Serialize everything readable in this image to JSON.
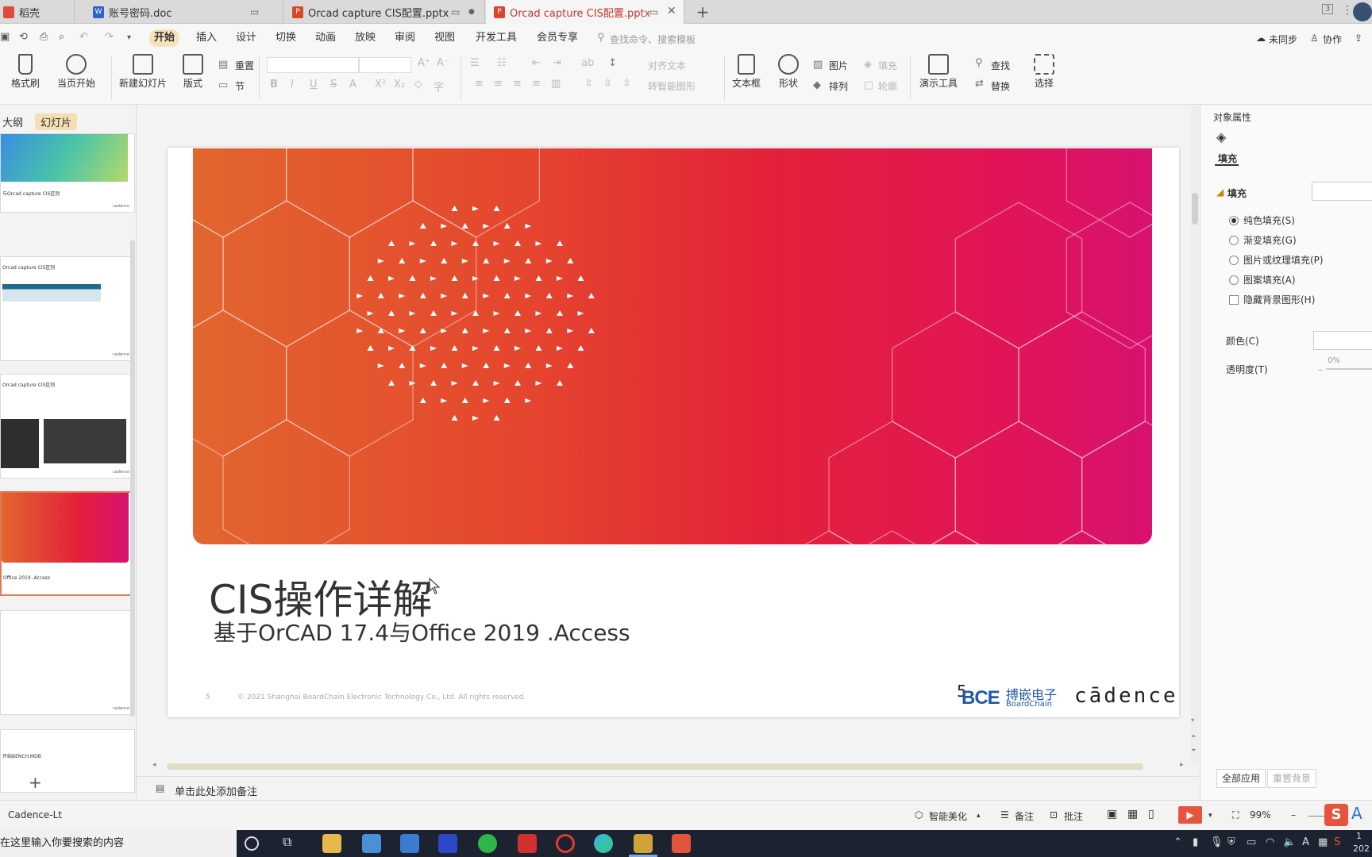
{
  "tabs": [
    {
      "label": "稻壳",
      "type": "daoke"
    },
    {
      "label": "账号密码.doc",
      "type": "doc"
    },
    {
      "label": "Orcad capture CIS配置.pptx",
      "type": "ppt"
    },
    {
      "label": "Orcad capture CIS配置.pptx",
      "type": "ppt",
      "active": true
    }
  ],
  "menu": {
    "items": [
      "开始",
      "插入",
      "设计",
      "切换",
      "动画",
      "放映",
      "审阅",
      "视图",
      "开发工具",
      "会员专享"
    ],
    "active": "开始",
    "search_placeholder": "查找命令、搜索模板",
    "sync": "未同步",
    "collab": "协作"
  },
  "ribbon": {
    "format_painter": "格式刷",
    "from_current": "当页开始",
    "new_slide": "新建幻灯片",
    "layout": "版式",
    "reset": "重置",
    "section": "节",
    "align_text": "对齐文本",
    "smartart": "转智能图形",
    "textbox": "文本框",
    "shape": "形状",
    "picture": "图片",
    "fill": "填充",
    "arrange": "排列",
    "outline": "轮廓",
    "presentation_tools": "演示工具",
    "find": "查找",
    "replace": "替换",
    "select": "选择"
  },
  "left_pane": {
    "tab_outline": "大纲",
    "tab_slides": "幻灯片",
    "thumbs": [
      {
        "title": "与Orcad capture CIS区别"
      },
      {
        "title": "Orcad capture CIS区别"
      },
      {
        "title": "Orcad capture CIS区别"
      },
      {
        "title": "Office 2019 .Access",
        "selected": true
      },
      {
        "title": ""
      },
      {
        "title": "开始BENCH.MDB"
      }
    ]
  },
  "slide": {
    "title": "CIS操作详解",
    "subtitle": "基于OrCAD 17.4与Office 2019 .Access",
    "number": "5",
    "copyright": "© 2021 Shanghai BoardChain Electronic Technology Co., Ltd. All rights reserved.",
    "logo_num": "5",
    "logo_bce": "BCE",
    "logo_cn": "搏嵌电子",
    "logo_en": "BoardChain",
    "logo_cadence": "cādence"
  },
  "notes_placeholder": "单击此处添加备注",
  "right_panel": {
    "header": "对象属性",
    "fill_tab": "填充",
    "fill_section": "填充",
    "options": [
      "纯色填充(S)",
      "渐变填充(G)",
      "图片或纹理填充(P)",
      "图案填充(A)"
    ],
    "selected_option": 0,
    "hide_bg": "隐藏背景图形(H)",
    "color_label": "颜色(C)",
    "transparency_label": "透明度(T)",
    "transparency_value": "0%",
    "apply_all": "全部应用",
    "reset_bg": "重置背景"
  },
  "status": {
    "theme": "Cadence-Lt",
    "beautify": "智能美化",
    "notes": "备注",
    "comments": "批注",
    "zoom": "99%"
  },
  "taskbar": {
    "search": "在这里输入你要搜索的内容",
    "clock_time": "1",
    "clock_year": "202"
  },
  "colors": {
    "accent": "#c0392b",
    "banner_start": "#e2662f",
    "banner_end": "#d7126f",
    "active_menu_bg": "#f6e2b8"
  }
}
